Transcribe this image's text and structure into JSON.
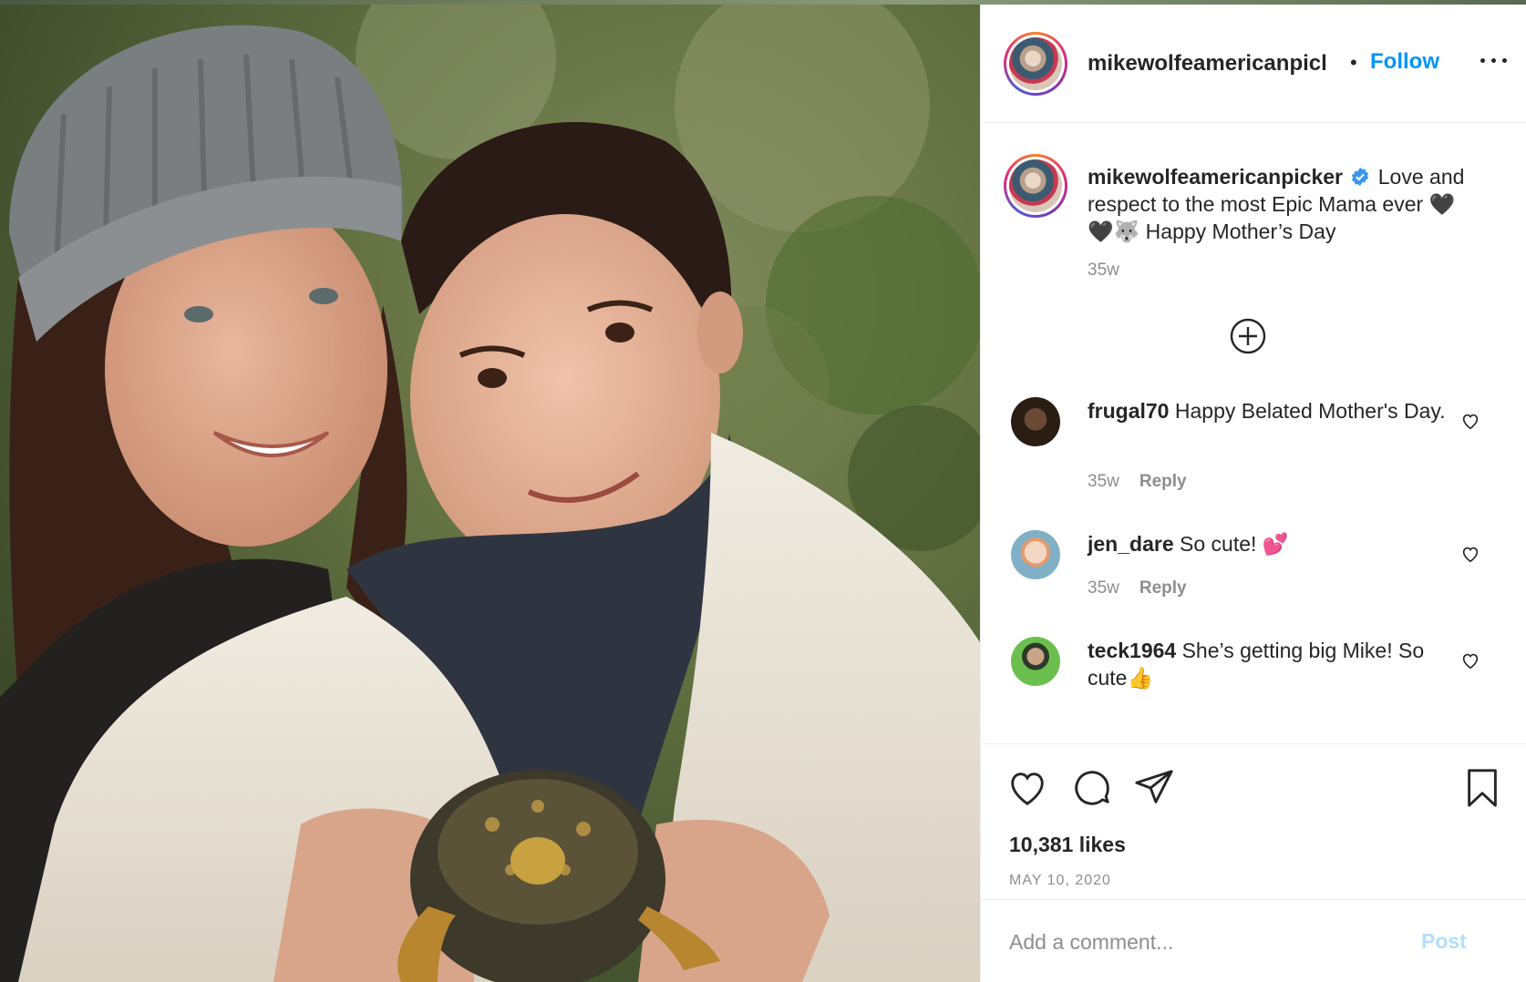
{
  "post": {
    "username": "mikewolfeamericanpicker",
    "header_username_display": "mikewolfeamericanpicl",
    "separator": "•",
    "follow_label": "Follow",
    "more_icon": "more-horizontal-icon",
    "verified_icon": "verified-badge-icon",
    "image_alt": "Woman in gray knit beanie and girl in white fleece coat holding a box turtle"
  },
  "caption": {
    "username": "mikewolfeamericanpicker",
    "text": "Love and respect to the most Epic Mama ever 🖤🖤🐺 Happy Mother’s Day",
    "time": "35w"
  },
  "load_more_icon": "plus-circle-icon",
  "comments": [
    {
      "username": "frugal70",
      "text": "Happy Belated Mother's Day.",
      "time": "35w",
      "reply_label": "Reply"
    },
    {
      "username": "jen_dare",
      "text": "So cute! 💕",
      "time": "35w",
      "reply_label": "Reply"
    },
    {
      "username": "teck1964",
      "text": "She’s getting big Mike! So cute👍"
    }
  ],
  "actions": {
    "like_icon": "heart-icon",
    "comment_icon": "comment-icon",
    "share_icon": "paper-plane-icon",
    "save_icon": "bookmark-icon",
    "likes": "10,381 likes",
    "date": "MAY 10, 2020"
  },
  "comment_box": {
    "placeholder": "Add a comment...",
    "post_label": "Post"
  },
  "colors": {
    "link": "#0095f6",
    "post_disabled": "#b2dffc",
    "muted": "#8e8e8e",
    "text": "#262626"
  }
}
